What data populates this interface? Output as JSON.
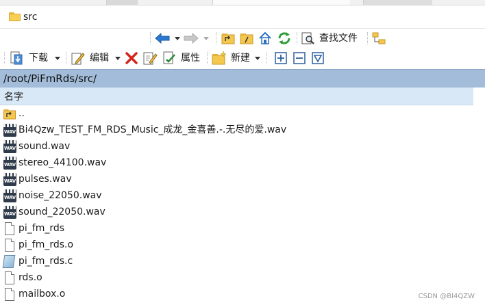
{
  "tab_bar": {
    "current_folder": "src"
  },
  "toolbar_top": {
    "find_files_label": "查找文件"
  },
  "toolbar_actions": {
    "download_label": "下载",
    "edit_label": "编辑",
    "properties_label": "属性",
    "new_label": "新建"
  },
  "path": "/root/PiFmRds/src/",
  "column_header": {
    "name": "名字"
  },
  "files": [
    {
      "name": "..",
      "icon": "parent-folder-icon"
    },
    {
      "name": "Bi4Qzw_TEST_FM_RDS_Music_成龙_金喜善.-.无尽的爱.wav",
      "icon": "wav-file-icon"
    },
    {
      "name": "sound.wav",
      "icon": "wav-file-icon"
    },
    {
      "name": "stereo_44100.wav",
      "icon": "wav-file-icon"
    },
    {
      "name": "pulses.wav",
      "icon": "wav-file-icon"
    },
    {
      "name": "noise_22050.wav",
      "icon": "wav-file-icon"
    },
    {
      "name": "sound_22050.wav",
      "icon": "wav-file-icon"
    },
    {
      "name": "pi_fm_rds",
      "icon": "file-icon"
    },
    {
      "name": "pi_fm_rds.o",
      "icon": "file-icon"
    },
    {
      "name": "pi_fm_rds.c",
      "icon": "c-source-file-icon"
    },
    {
      "name": "rds.o",
      "icon": "file-icon"
    },
    {
      "name": "mailbox.o",
      "icon": "file-icon"
    }
  ],
  "watermark": "CSDN @BI4QZW",
  "colors": {
    "path_bar": "#a3bcd9",
    "column_header": "#d8e8f6"
  }
}
